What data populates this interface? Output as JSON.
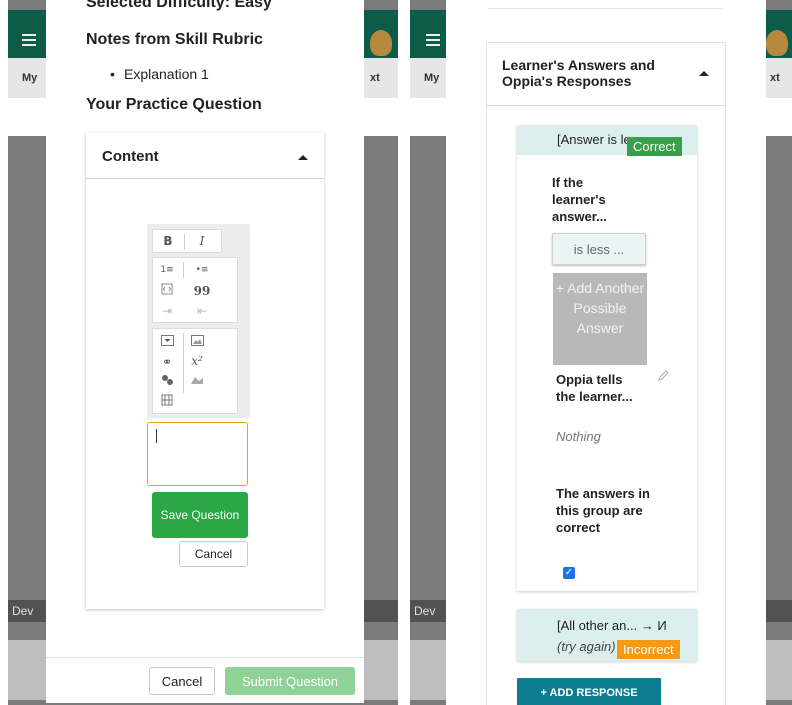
{
  "left": {
    "background": {
      "subbar_left": "My",
      "subbar_right": "xt",
      "dev_label": "Dev"
    },
    "selected_difficulty": "Selected Difficulty: Easy",
    "notes_heading": "Notes from Skill Rubric",
    "notes_items": [
      "Explanation 1"
    ],
    "practice_heading": "Your Practice Question",
    "content_title": "Content",
    "toolbar": {
      "bold": "B",
      "italic": "I",
      "numbered_list": "1≡",
      "bulleted_list": "•≡",
      "quote": "99",
      "superscript": "x²"
    },
    "save_question_label": "Save Question",
    "cancel_label": "Cancel",
    "footer_cancel_label": "Cancel",
    "submit_question_label": "Submit Question"
  },
  "right": {
    "background": {
      "subbar_left": "My",
      "subbar_right": "xt",
      "dev_label": "Dev"
    },
    "section_title": "Learner's Answers and Oppia's Responses",
    "answer_group": {
      "header_text": "[Answer is less ...",
      "status_tag": "Correct",
      "if_learner_label": "If the learner's answer...",
      "rule_chip": "is less ...",
      "add_answer_label": "+ Add Another Possible Answer",
      "oppia_tells_label": "Oppia tells the learner...",
      "feedback_value": "Nothing",
      "correct_label": "The answers in this group are correct",
      "correct_checked": true
    },
    "default_group": {
      "header_text": "[All other an... → И",
      "sub_text": "(try again)",
      "status_tag": "Incorrect"
    },
    "add_response_label": "+ ADD RESPONSE"
  },
  "colors": {
    "topbar": "#0d5c4a",
    "save_green": "#2aa744",
    "submit_green_disabled": "#8fd197",
    "correct_tag": "#3a9f4a",
    "incorrect_tag": "#f59a14",
    "add_response": "#0e7c8f",
    "editor_focus": "#e3a21a"
  }
}
